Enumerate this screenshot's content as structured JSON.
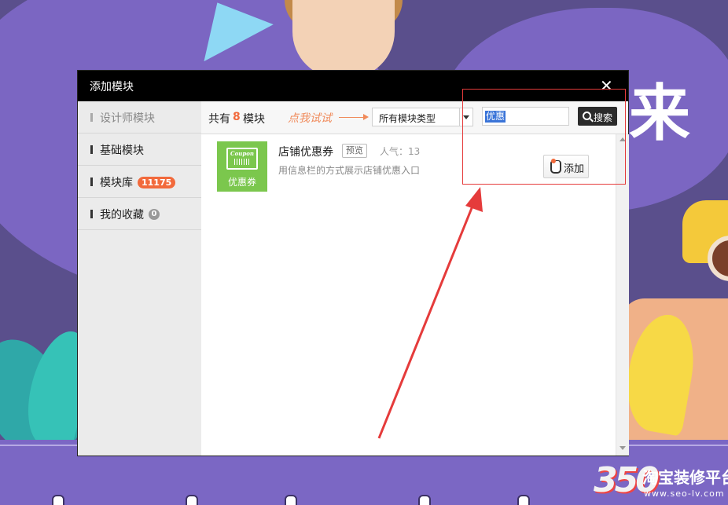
{
  "dialog": {
    "title": "添加模块",
    "close_glyph": "✕"
  },
  "sidebar": {
    "items": [
      {
        "label": "设计师模块",
        "badge": ""
      },
      {
        "label": "基础模块",
        "badge": ""
      },
      {
        "label": "模块库",
        "badge": "11175"
      },
      {
        "label": "我的收藏",
        "badge": "0"
      }
    ]
  },
  "toolbar": {
    "count_prefix": "共有",
    "count": "8",
    "count_suffix": "模块",
    "hint": "点我试试",
    "type_select_value": "所有模块类型",
    "search_value": "优惠",
    "search_button": "搜索"
  },
  "modules": [
    {
      "thumb_word": "Coupon",
      "thumb_label": "优惠券",
      "title": "店铺优惠券",
      "preview": "预览",
      "popularity_label": "人气：",
      "popularity": "13",
      "description": "用信息栏的方式展示店铺优惠入口",
      "add_label": "添加"
    }
  ],
  "background": {
    "chars": [
      "来"
    ]
  },
  "watermark": {
    "number": "350",
    "title": "淘宝装修平台",
    "url": "www.seo-lv.com"
  },
  "colors": {
    "accent": "#f26a3c",
    "header": "#000000",
    "thumb": "#7bc74d",
    "annotation": "#e53b3b",
    "selection": "#3a74d8"
  }
}
